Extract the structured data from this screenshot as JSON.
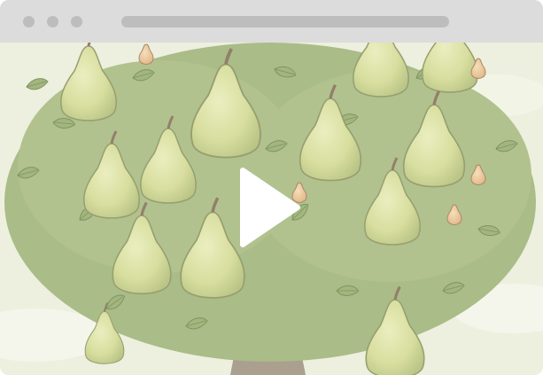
{
  "window": {
    "controls": [
      "window-dot-icon",
      "window-dot-icon",
      "window-dot-icon"
    ],
    "address_bar": ""
  },
  "video": {
    "subject": "pear-tree-illustration",
    "control_icon": "play-icon"
  },
  "colors": {
    "chrome": "#dcdcdc",
    "chrome_detail": "#bdbdbd",
    "play_button": "#ffffff",
    "leaf": "#7f9a4c",
    "pear": "#c9d27a",
    "trunk": "#8b7a66",
    "sky": "#e6ead2"
  }
}
